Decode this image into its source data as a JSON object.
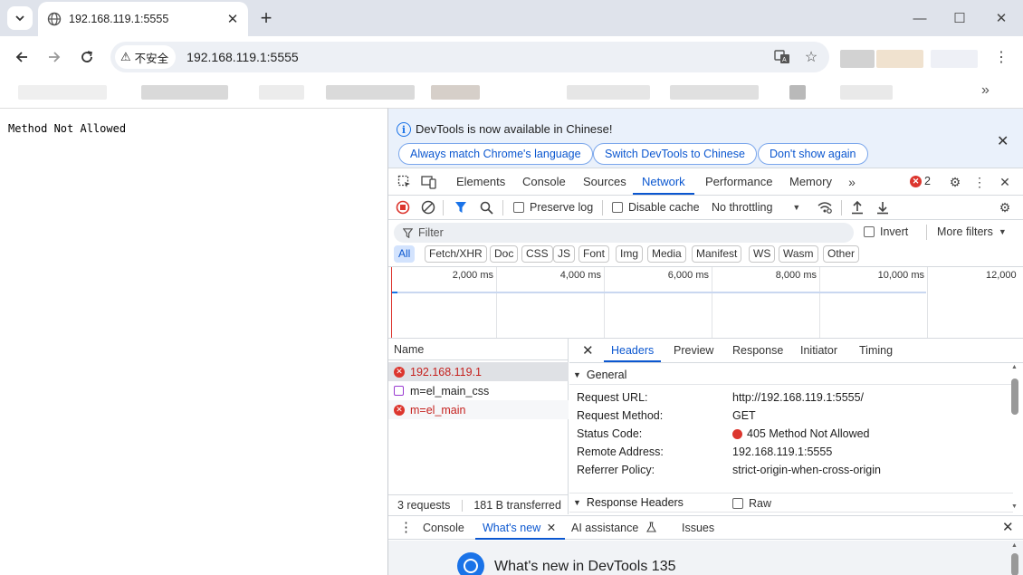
{
  "tab": {
    "title": "192.168.119.1:5555"
  },
  "omnibox": {
    "security_label": "不安全",
    "url": "192.168.119.1:5555"
  },
  "page": {
    "body_text": "Method Not Allowed"
  },
  "devtools": {
    "infobar": {
      "message": "DevTools is now available in Chinese!",
      "btn_match": "Always match Chrome's language",
      "btn_switch": "Switch DevTools to Chinese",
      "btn_dismiss": "Don't show again"
    },
    "panels": [
      "Elements",
      "Console",
      "Sources",
      "Network",
      "Performance",
      "Memory"
    ],
    "active_panel": "Network",
    "error_count": "2",
    "network_toolbar": {
      "preserve_log": "Preserve log",
      "disable_cache": "Disable cache",
      "throttling": "No throttling"
    },
    "filter": {
      "placeholder": "Filter",
      "invert": "Invert",
      "more_filters": "More filters"
    },
    "type_filters": [
      "All",
      "Fetch/XHR",
      "Doc",
      "CSS",
      "JS",
      "Font",
      "Img",
      "Media",
      "Manifest",
      "WS",
      "Wasm",
      "Other"
    ],
    "timeline_labels": [
      "2,000 ms",
      "4,000 ms",
      "6,000 ms",
      "8,000 ms",
      "10,000 ms",
      "12,000"
    ],
    "requests": {
      "header": "Name",
      "rows": [
        {
          "name": "192.168.119.1",
          "status": "error"
        },
        {
          "name": "m=el_main_css",
          "status": "ok"
        },
        {
          "name": "m=el_main",
          "status": "error"
        }
      ],
      "summary_count": "3 requests",
      "summary_transferred": "181 B transferred"
    },
    "detail_tabs": [
      "Headers",
      "Preview",
      "Response",
      "Initiator",
      "Timing"
    ],
    "general": {
      "title": "General",
      "rows": [
        {
          "key": "Request URL:",
          "value": "http://192.168.119.1:5555/"
        },
        {
          "key": "Request Method:",
          "value": "GET"
        },
        {
          "key": "Status Code:",
          "value": "405 Method Not Allowed"
        },
        {
          "key": "Remote Address:",
          "value": "192.168.119.1:5555"
        },
        {
          "key": "Referrer Policy:",
          "value": "strict-origin-when-cross-origin"
        }
      ]
    },
    "response_headers": {
      "title": "Response Headers",
      "raw_label": "Raw"
    },
    "drawer": {
      "tabs": [
        "Console",
        "What's new",
        "AI assistance",
        "Issues"
      ],
      "active": "What's new",
      "whats_new_title": "What's new in DevTools 135"
    }
  },
  "colors": {
    "accent": "#0b57d0",
    "error": "#dc362e"
  }
}
